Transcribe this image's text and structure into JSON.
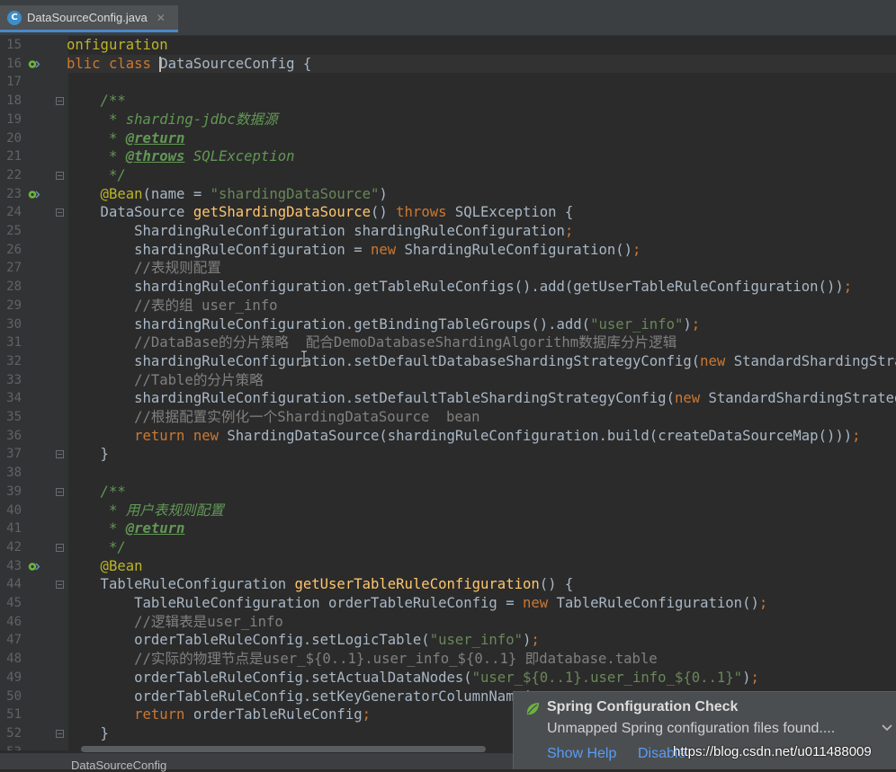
{
  "tab": {
    "icon_letter": "C",
    "title": "DataSourceConfig.java",
    "close": "✕"
  },
  "lines": [
    {
      "n": "15",
      "parts": [
        {
          "t": "onfiguration",
          "c": "a"
        }
      ]
    },
    {
      "n": "16",
      "marker": "bean",
      "parts": [
        {
          "t": "blic class ",
          "c": "k"
        },
        {
          "t": "DataSourceConfig {",
          "c": "p"
        }
      ]
    },
    {
      "n": "17",
      "parts": []
    },
    {
      "n": "18",
      "fold": true,
      "parts": [
        {
          "t": "    /**",
          "c": "d"
        }
      ]
    },
    {
      "n": "19",
      "parts": [
        {
          "t": "     * sharding-jdbc数据源",
          "c": "d"
        }
      ]
    },
    {
      "n": "20",
      "parts": [
        {
          "t": "     * ",
          "c": "d"
        },
        {
          "t": "@return",
          "c": "dt"
        }
      ]
    },
    {
      "n": "21",
      "parts": [
        {
          "t": "     * ",
          "c": "d"
        },
        {
          "t": "@throws",
          "c": "dt"
        },
        {
          "t": " SQLException",
          "c": "d"
        }
      ]
    },
    {
      "n": "22",
      "fold": true,
      "parts": [
        {
          "t": "     */",
          "c": "d"
        }
      ]
    },
    {
      "n": "23",
      "marker": "bean",
      "parts": [
        {
          "t": "    @Bean",
          "c": "a"
        },
        {
          "t": "(name = ",
          "c": "p"
        },
        {
          "t": "\"shardingDataSource\"",
          "c": "s"
        },
        {
          "t": ")",
          "c": "p"
        }
      ]
    },
    {
      "n": "24",
      "fold": true,
      "parts": [
        {
          "t": "    DataSource ",
          "c": "p"
        },
        {
          "t": "getShardingDataSource",
          "c": "m"
        },
        {
          "t": "() ",
          "c": "p"
        },
        {
          "t": "throws ",
          "c": "k"
        },
        {
          "t": "SQLException {",
          "c": "p"
        }
      ]
    },
    {
      "n": "25",
      "parts": [
        {
          "t": "        ShardingRuleConfiguration shardingRuleConfiguration",
          "c": "p"
        },
        {
          "t": ";",
          "c": "k"
        }
      ]
    },
    {
      "n": "26",
      "parts": [
        {
          "t": "        shardingRuleConfiguration = ",
          "c": "p"
        },
        {
          "t": "new ",
          "c": "k"
        },
        {
          "t": "ShardingRuleConfiguration()",
          "c": "p"
        },
        {
          "t": ";",
          "c": "k"
        }
      ]
    },
    {
      "n": "27",
      "parts": [
        {
          "t": "        //表规则配置",
          "c": "c"
        }
      ]
    },
    {
      "n": "28",
      "parts": [
        {
          "t": "        shardingRuleConfiguration.getTableRuleConfigs().add(getUserTableRuleConfiguration())",
          "c": "p"
        },
        {
          "t": ";",
          "c": "k"
        }
      ]
    },
    {
      "n": "29",
      "parts": [
        {
          "t": "        //表的组 user_info",
          "c": "c"
        }
      ]
    },
    {
      "n": "30",
      "parts": [
        {
          "t": "        shardingRuleConfiguration.getBindingTableGroups().add(",
          "c": "p"
        },
        {
          "t": "\"user_info\"",
          "c": "s"
        },
        {
          "t": ")",
          "c": "p"
        },
        {
          "t": ";",
          "c": "k"
        }
      ]
    },
    {
      "n": "31",
      "parts": [
        {
          "t": "        //DataBase的分片策略  配合DemoDatabaseShardingAlgorithm数据库分片逻辑",
          "c": "c"
        }
      ]
    },
    {
      "n": "32",
      "parts": [
        {
          "t": "        shardingRuleConfiguration.setDefaultDatabaseShardingStrategyConfig(",
          "c": "p"
        },
        {
          "t": "new ",
          "c": "k"
        },
        {
          "t": "StandardShardingStrategyConfiguration(",
          "c": "p"
        }
      ]
    },
    {
      "n": "33",
      "parts": [
        {
          "t": "        //Table的分片策略",
          "c": "c"
        }
      ]
    },
    {
      "n": "34",
      "parts": [
        {
          "t": "        shardingRuleConfiguration.setDefaultTableShardingStrategyConfig(",
          "c": "p"
        },
        {
          "t": "new ",
          "c": "k"
        },
        {
          "t": "StandardShardingStrategyConfiguration(",
          "c": "p"
        }
      ]
    },
    {
      "n": "35",
      "parts": [
        {
          "t": "        //根据配置实例化一个ShardingDataSource  bean",
          "c": "c"
        }
      ]
    },
    {
      "n": "36",
      "parts": [
        {
          "t": "        return new ",
          "c": "k"
        },
        {
          "t": "ShardingDataSource(shardingRuleConfiguration.build(createDataSourceMap()))",
          "c": "p"
        },
        {
          "t": ";",
          "c": "k"
        }
      ]
    },
    {
      "n": "37",
      "fold": true,
      "parts": [
        {
          "t": "    }",
          "c": "p"
        }
      ]
    },
    {
      "n": "38",
      "parts": []
    },
    {
      "n": "39",
      "fold": true,
      "parts": [
        {
          "t": "    /**",
          "c": "d"
        }
      ]
    },
    {
      "n": "40",
      "parts": [
        {
          "t": "     * 用户表规则配置",
          "c": "d"
        }
      ]
    },
    {
      "n": "41",
      "parts": [
        {
          "t": "     * ",
          "c": "d"
        },
        {
          "t": "@return",
          "c": "dt"
        }
      ]
    },
    {
      "n": "42",
      "fold": true,
      "parts": [
        {
          "t": "     */",
          "c": "d"
        }
      ]
    },
    {
      "n": "43",
      "marker": "bean",
      "parts": [
        {
          "t": "    @Bean",
          "c": "a"
        }
      ]
    },
    {
      "n": "44",
      "fold": true,
      "parts": [
        {
          "t": "    TableRuleConfiguration ",
          "c": "p"
        },
        {
          "t": "getUserTableRuleConfiguration",
          "c": "m"
        },
        {
          "t": "() {",
          "c": "p"
        }
      ]
    },
    {
      "n": "45",
      "parts": [
        {
          "t": "        TableRuleConfiguration orderTableRuleConfig = ",
          "c": "p"
        },
        {
          "t": "new ",
          "c": "k"
        },
        {
          "t": "TableRuleConfiguration()",
          "c": "p"
        },
        {
          "t": ";",
          "c": "k"
        }
      ]
    },
    {
      "n": "46",
      "parts": [
        {
          "t": "        //逻辑表是user_info",
          "c": "c"
        }
      ]
    },
    {
      "n": "47",
      "parts": [
        {
          "t": "        orderTableRuleConfig.setLogicTable(",
          "c": "p"
        },
        {
          "t": "\"user_info\"",
          "c": "s"
        },
        {
          "t": ")",
          "c": "p"
        },
        {
          "t": ";",
          "c": "k"
        }
      ]
    },
    {
      "n": "48",
      "parts": [
        {
          "t": "        //实际的物理节点是user_${0..1}.user_info_${0..1} 即database.table",
          "c": "c"
        }
      ]
    },
    {
      "n": "49",
      "parts": [
        {
          "t": "        orderTableRuleConfig.setActualDataNodes(",
          "c": "p"
        },
        {
          "t": "\"user_${0..1}.user_info_${0..1}\"",
          "c": "s"
        },
        {
          "t": ")",
          "c": "p"
        },
        {
          "t": ";",
          "c": "k"
        }
      ]
    },
    {
      "n": "50",
      "parts": [
        {
          "t": "        orderTableRuleConfig.setKeyGeneratorColumnName(",
          "c": "p"
        }
      ]
    },
    {
      "n": "51",
      "parts": [
        {
          "t": "        return ",
          "c": "k"
        },
        {
          "t": "orderTableRuleConfig",
          "c": "p"
        },
        {
          "t": ";",
          "c": "k"
        }
      ]
    },
    {
      "n": "52",
      "fold": true,
      "parts": [
        {
          "t": "    }",
          "c": "p"
        }
      ]
    },
    {
      "n": "53",
      "parts": []
    }
  ],
  "breadcrumb": "DataSourceConfig",
  "notification": {
    "title": "Spring Configuration Check",
    "body": "Unmapped Spring configuration files found....",
    "link_help": "Show Help",
    "link_disable": "Disable"
  },
  "watermark": "https://blog.csdn.net/u011488009",
  "colors": {
    "background": "#2b2b2b",
    "gutter": "#313335",
    "keyword": "#cc7832",
    "string": "#6a8759",
    "comment": "#808080",
    "doc": "#629755",
    "annotation": "#bbb529",
    "method": "#ffc66d"
  }
}
